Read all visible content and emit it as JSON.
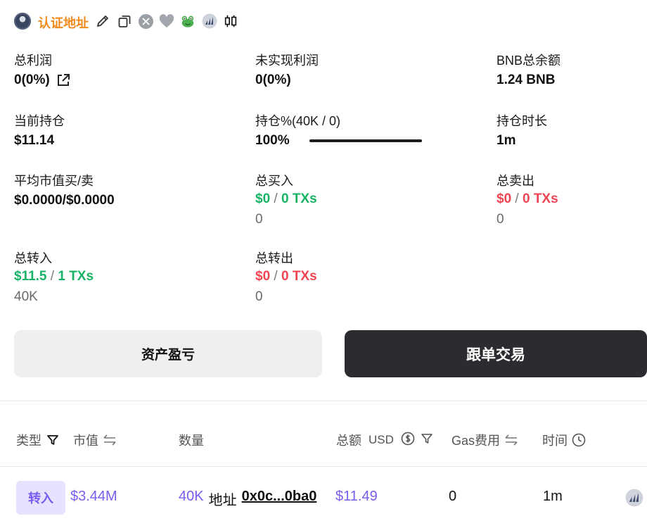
{
  "header": {
    "verified_label": "认证地址",
    "icons": [
      "avatar",
      "edit-icon",
      "copy-icon",
      "x-logo-icon",
      "heart-icon",
      "frog-icon",
      "chart-badge-icon",
      "candlestick-icon"
    ],
    "accent_color": "#f28a1b"
  },
  "stats": {
    "total_pnl": {
      "label": "总利润",
      "value": "0(0%)"
    },
    "unrealized_pnl": {
      "label": "未实现利润",
      "value": "0(0%)"
    },
    "bnb_balance": {
      "label": "BNB总余额",
      "value": "1.24 BNB"
    },
    "current_position": {
      "label": "当前持仓",
      "value": "$11.14"
    },
    "holding_pct": {
      "label": "持仓%(40K / 0)",
      "value": "100%",
      "progress": 1.0
    },
    "holding_duration": {
      "label": "持仓时长",
      "value": "1m"
    },
    "avg_mcap": {
      "label": "平均市值买/卖",
      "value": "$0.0000/$0.0000"
    },
    "total_buy": {
      "label": "总买入",
      "amount": "$0",
      "separator": "/",
      "txs": "0 TXs",
      "qty": "0"
    },
    "total_sell": {
      "label": "总卖出",
      "amount": "$0",
      "separator": "/",
      "txs": "0 TXs",
      "qty": "0"
    },
    "total_in": {
      "label": "总转入",
      "amount": "$11.5",
      "separator": "/",
      "txs": "1 TXs",
      "qty": "40K"
    },
    "total_out": {
      "label": "总转出",
      "amount": "$0",
      "separator": "/",
      "txs": "0 TXs",
      "qty": "0"
    }
  },
  "buttons": {
    "pnl": "资产盈亏",
    "copy_trade": "跟单交易"
  },
  "table": {
    "headers": {
      "type": "类型",
      "mcap": "市值",
      "qty": "数量",
      "total": "总额",
      "usd": "USD",
      "gas": "Gas费用",
      "time": "时间"
    },
    "rows": [
      {
        "type": "转入",
        "mcap": "$3.44M",
        "qty": "40K",
        "addr_label": "地址",
        "address": "0x0c...0ba0",
        "total": "$11.49",
        "gas": "0",
        "time": "1m"
      }
    ]
  }
}
